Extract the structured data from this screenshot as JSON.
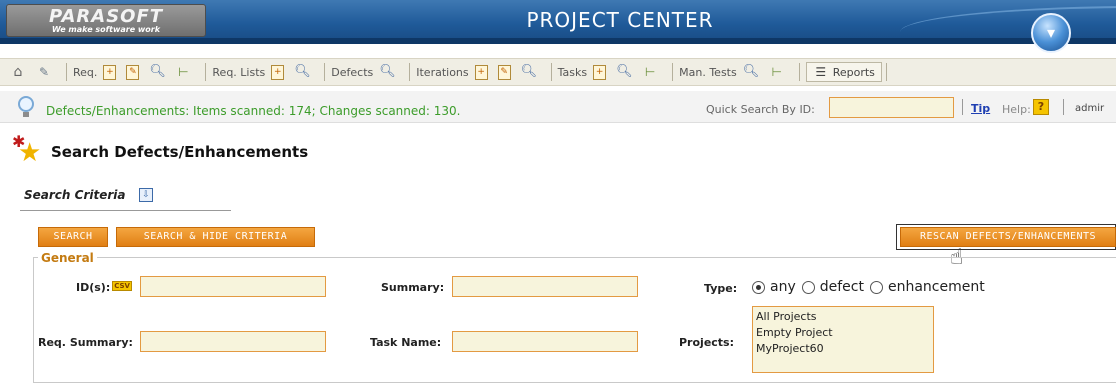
{
  "banner": {
    "logo_text": "PARASOFT",
    "logo_tagline": "We make software work",
    "title": "PROJECT CENTER",
    "menu_icon": "chevron-down-icon"
  },
  "toolbar": {
    "home_icon": "home-icon",
    "tools_icon": "tools-icon",
    "req_label": "Req.",
    "req_lists_label": "Req. Lists",
    "defects_label": "Defects",
    "iterations_label": "Iterations",
    "tasks_label": "Tasks",
    "man_tests_label": "Man. Tests",
    "reports_label": "Reports"
  },
  "status": {
    "message": "Defects/Enhancements: Items scanned: 174; Changes scanned: 130.",
    "message_color": "#3c9c2a",
    "quick_search_label": "Quick Search By ID:",
    "quick_search_value": "",
    "tip_label": "Tip",
    "help_label": "Help:",
    "help_glyph": "?",
    "user": "admir"
  },
  "page": {
    "title": "Search Defects/Enhancements",
    "criteria_label": "Search Criteria"
  },
  "buttons": {
    "search": "SEARCH",
    "search_hide": "SEARCH & HIDE CRITERIA",
    "rescan": "RESCAN DEFECTS/ENHANCEMENTS",
    "accent_color": "#e88f22"
  },
  "general": {
    "legend": "General",
    "ids_label": "ID(s):",
    "csv_badge": "CSV",
    "ids_value": "",
    "summary_label": "Summary:",
    "summary_value": "",
    "type_label": "Type:",
    "type_options": [
      "any",
      "defect",
      "enhancement"
    ],
    "type_selected": "any",
    "req_summary_label": "Req. Summary:",
    "req_summary_value": "",
    "task_name_label": "Task Name:",
    "task_name_value": "",
    "projects_label": "Projects:",
    "projects": [
      "All Projects",
      "Empty Project",
      "MyProject60"
    ]
  }
}
